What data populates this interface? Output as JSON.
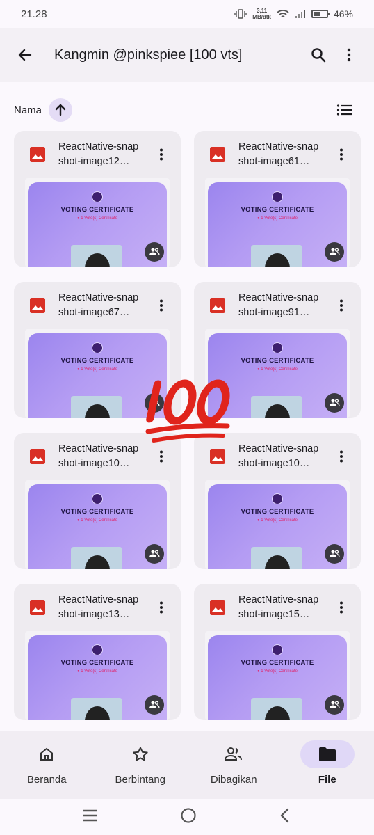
{
  "status": {
    "time": "21.28",
    "net_speed_value": "3,11",
    "net_speed_unit": "MB/dtk",
    "battery": "46%"
  },
  "app_bar": {
    "title": "Kangmin @pinkspiee [100 vts]"
  },
  "sort": {
    "label": "Nama"
  },
  "thumbnail": {
    "title": "VOTING CERTIFICATE",
    "subtitle": "1 Vote(s) Certificate"
  },
  "files": [
    {
      "name": "ReactNative-snapshot-image12…"
    },
    {
      "name": "ReactNative-snapshot-image61…"
    },
    {
      "name": "ReactNative-snapshot-image67…"
    },
    {
      "name": "ReactNative-snapshot-image91…"
    },
    {
      "name": "ReactNative-snapshot-image10…"
    },
    {
      "name": "ReactNative-snapshot-image10…"
    },
    {
      "name": "ReactNative-snapshot-image13…"
    },
    {
      "name": "ReactNative-snapshot-image15…"
    }
  ],
  "bottom_nav": [
    {
      "label": "Beranda",
      "icon": "home-icon",
      "active": false
    },
    {
      "label": "Berbintang",
      "icon": "star-icon",
      "active": false
    },
    {
      "label": "Dibagikan",
      "icon": "people-icon",
      "active": false
    },
    {
      "label": "File",
      "icon": "folder-icon",
      "active": true
    }
  ],
  "sticker": {
    "text": "100",
    "icon": "hundred-points-emoji"
  },
  "colors": {
    "accent_bg": "#e0d8f7",
    "card_bg": "#eeebf0",
    "image_icon_red": "#d93025",
    "sticker_red": "#e0241c"
  }
}
